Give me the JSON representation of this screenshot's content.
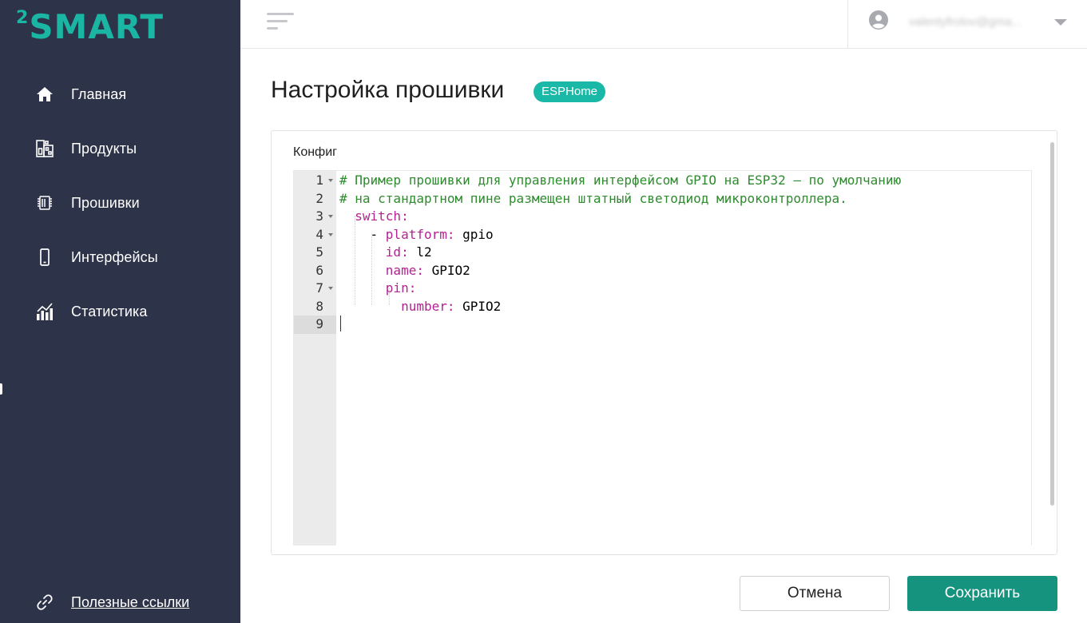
{
  "app": {
    "logo_superscript": "2",
    "logo_text": "SMART"
  },
  "sidebar": {
    "items": [
      {
        "label": "Главная",
        "icon": "home-icon"
      },
      {
        "label": "Продукты",
        "icon": "products-icon"
      },
      {
        "label": "Прошивки",
        "icon": "chip-icon"
      },
      {
        "label": "Интерфейсы",
        "icon": "phone-icon"
      },
      {
        "label": "Статистика",
        "icon": "stats-icon"
      }
    ],
    "links_label": "Полезные ссылки"
  },
  "header": {
    "user_email": "valentyfrolov@gma..."
  },
  "main": {
    "title": "Настройка прошивки",
    "badge": "ESPHome",
    "config_label": "Конфиг"
  },
  "editor": {
    "line_numbers": [
      "1",
      "2",
      "3",
      "4",
      "5",
      "6",
      "7",
      "8",
      "9"
    ],
    "active_line": 9,
    "lines": [
      [
        {
          "t": "# Пример прошивки для управления интерфейсом GPIO на ESP32 — по умолчанию",
          "c": "comment"
        }
      ],
      [
        {
          "t": "# на стандартном пине размещен штатный светодиод микроконтроллера.",
          "c": "comment"
        }
      ],
      [
        {
          "t": "  ",
          "c": "val"
        },
        {
          "t": "switch:",
          "c": "key"
        }
      ],
      [
        {
          "t": "    - ",
          "c": "val"
        },
        {
          "t": "platform:",
          "c": "key"
        },
        {
          "t": " gpio",
          "c": "val"
        }
      ],
      [
        {
          "t": "      ",
          "c": "val"
        },
        {
          "t": "id:",
          "c": "key"
        },
        {
          "t": " l2",
          "c": "val"
        }
      ],
      [
        {
          "t": "      ",
          "c": "val"
        },
        {
          "t": "name:",
          "c": "key"
        },
        {
          "t": " GPIO2",
          "c": "val"
        }
      ],
      [
        {
          "t": "      ",
          "c": "val"
        },
        {
          "t": "pin:",
          "c": "key"
        }
      ],
      [
        {
          "t": "        ",
          "c": "val"
        },
        {
          "t": "number:",
          "c": "key"
        },
        {
          "t": " GPIO2",
          "c": "val"
        }
      ],
      [
        {
          "t": "",
          "c": "val"
        }
      ]
    ]
  },
  "actions": {
    "cancel_label": "Отмена",
    "save_label": "Сохранить"
  },
  "colors": {
    "sidebar_bg": "#2d3349",
    "accent": "#1ab8a7",
    "save_button": "#16937f"
  }
}
